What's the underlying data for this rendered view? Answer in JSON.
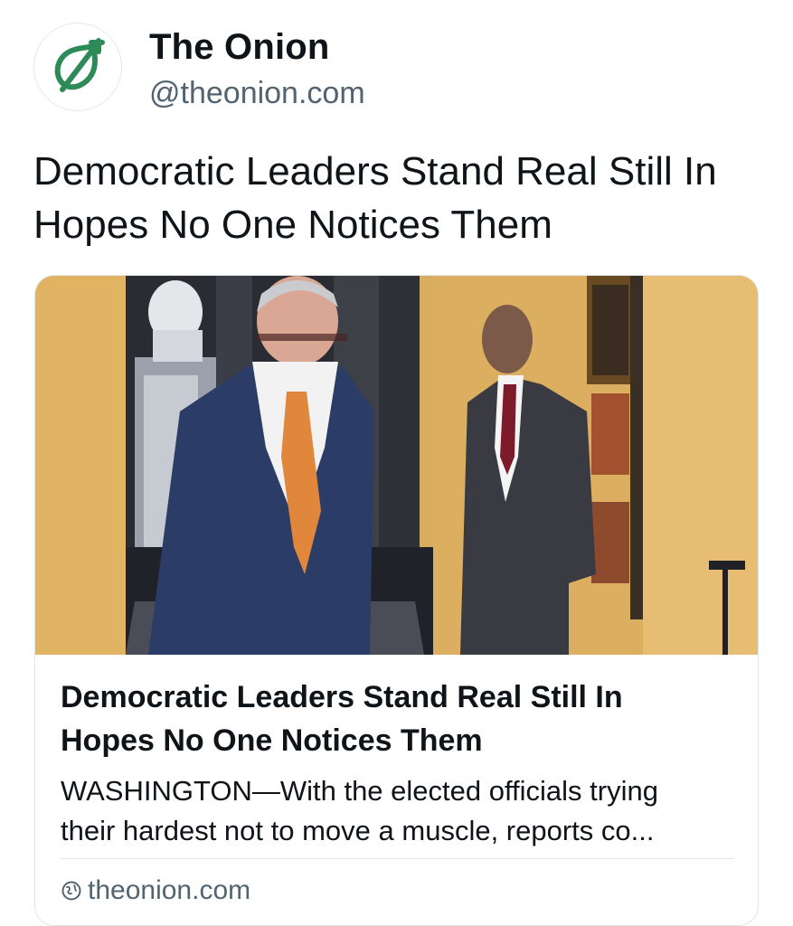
{
  "account": {
    "display_name": "The Onion",
    "handle": "@theonion.com",
    "avatar_icon": "onion-logo-icon",
    "logo_color": "#2e8b57"
  },
  "post": {
    "text": "Democratic Leaders Stand Real Still In Hopes No One Notices Them"
  },
  "link_card": {
    "image_icon": "article-photo",
    "title_lines": [
      "Democratic Leaders Stand Real Still In",
      "Hopes No One Notices Them"
    ],
    "description_lines": [
      "WASHINGTON—With the elected officials trying",
      "their hardest not to move a muscle, reports co..."
    ],
    "domain_icon": "globe-icon",
    "domain": "theonion.com"
  }
}
